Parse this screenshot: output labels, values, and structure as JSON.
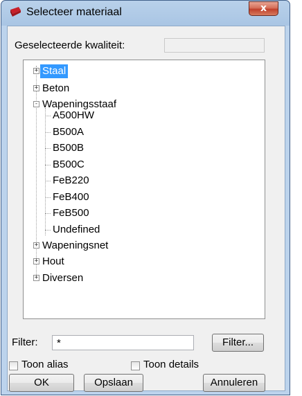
{
  "window": {
    "title": "Selecteer materiaal",
    "close_label": "x"
  },
  "kwaliteit": {
    "label": "Geselecteerde kwaliteit:",
    "value": ""
  },
  "tree": {
    "nodes": [
      {
        "label": "Staal",
        "expander": "+",
        "selected": true
      },
      {
        "label": "Beton",
        "expander": "+"
      },
      {
        "label": "Wapeningsstaaf",
        "expander": "-",
        "children": [
          "A500HW",
          "B500A",
          "B500B",
          "B500C",
          "FeB220",
          "FeB400",
          "FeB500",
          "Undefined"
        ]
      },
      {
        "label": "Wapeningsnet",
        "expander": "+"
      },
      {
        "label": "Hout",
        "expander": "+"
      },
      {
        "label": "Diversen",
        "expander": "+"
      }
    ]
  },
  "filter": {
    "label": "Filter:",
    "value": "*",
    "button": "Filter..."
  },
  "options": {
    "toon_alias": "Toon alias",
    "toon_details": "Toon details"
  },
  "buttons": {
    "ok": "OK",
    "opslaan": "Opslaan",
    "annuleren": "Annuleren"
  }
}
